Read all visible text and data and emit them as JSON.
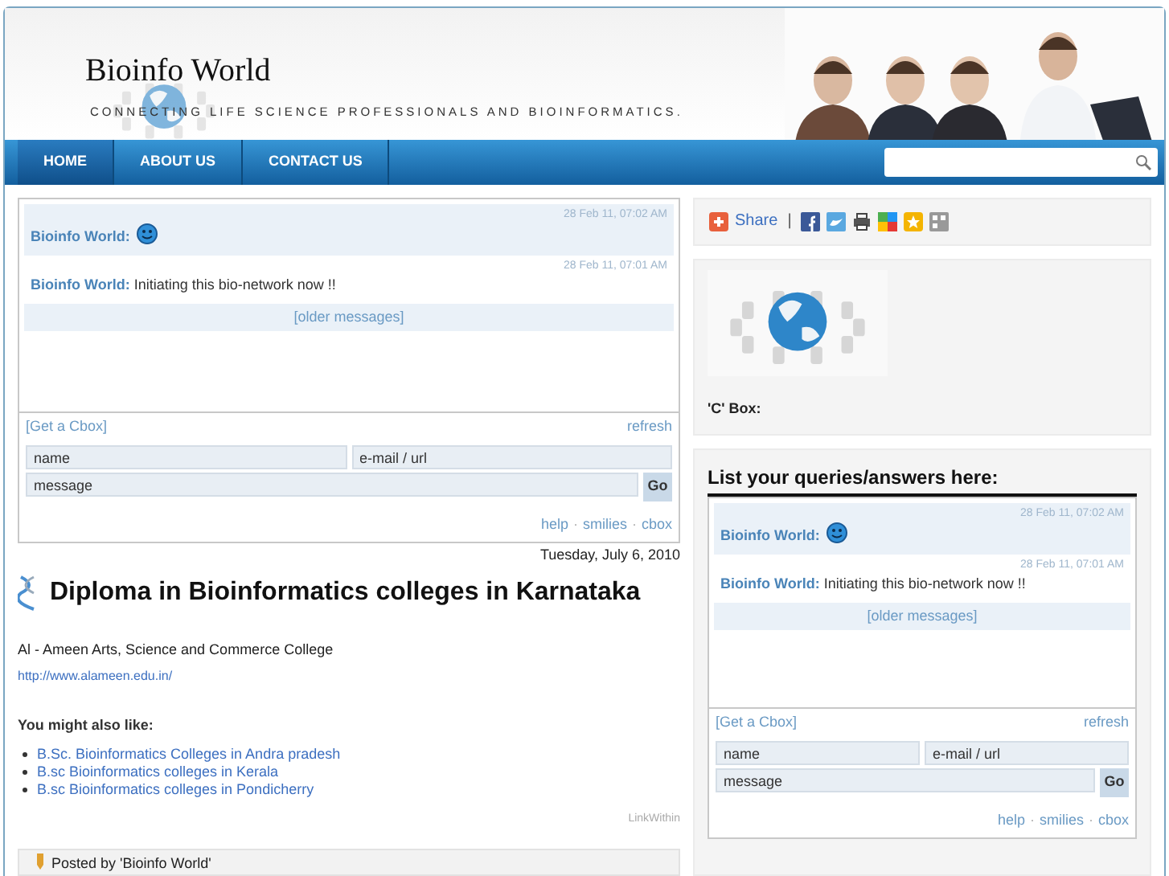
{
  "header": {
    "title": "Bioinfo World",
    "tagline": "CONNECTING LIFE SCIENCE PROFESSIONALS AND BIOINFORMATICS."
  },
  "nav": {
    "tabs": [
      {
        "label": "HOME",
        "selected": true
      },
      {
        "label": "ABOUT US",
        "selected": false
      },
      {
        "label": "CONTACT US",
        "selected": false
      }
    ]
  },
  "main_cbox": {
    "messages": [
      {
        "kind": "smiley",
        "time": "28 Feb 11, 07:02 AM",
        "author": "Bioinfo World:"
      },
      {
        "kind": "text",
        "time": "28 Feb 11, 07:01 AM",
        "author": "Bioinfo World:",
        "text": "Initiating this bio-network now !!"
      }
    ],
    "older": "[older messages]",
    "get_link": "[Get a Cbox]",
    "refresh": "refresh",
    "name_placeholder": "name",
    "email_placeholder": "e-mail / url",
    "message_placeholder": "message",
    "go": "Go",
    "footer_links": [
      "help",
      "smilies",
      "cbox"
    ],
    "separator": "·"
  },
  "post": {
    "date": "Tuesday, July 6, 2010",
    "title": "Diploma in Bioinformatics colleges in Karnataka",
    "body": "Al - Ameen Arts, Science and Commerce College",
    "link": "http://www.alameen.edu.in/",
    "related_heading": "You might also like:",
    "related": [
      "B.Sc. Bioinformatics Colleges in Andra pradesh",
      "B.sc Bioinformatics colleges in Kerala",
      "B.sc Bioinformatics colleges in Pondicherry"
    ],
    "credit": "LinkWithin",
    "posted_by": "Posted by 'Bioinfo World'"
  },
  "sidebar": {
    "share": {
      "label": "Share",
      "separator": "|"
    },
    "cbox_caption": "'C' Box:",
    "queries_heading": "List your queries/answers here:",
    "cbox": {
      "messages": [
        {
          "kind": "smiley",
          "time": "28 Feb 11, 07:02 AM",
          "author": "Bioinfo World:"
        },
        {
          "kind": "text",
          "time": "28 Feb 11, 07:01 AM",
          "author": "Bioinfo World:",
          "text": "Initiating this bio-network now !!"
        }
      ],
      "older": "[older messages]",
      "get_link": "[Get a Cbox]",
      "refresh": "refresh",
      "name_placeholder": "name",
      "email_placeholder": "e-mail / url",
      "message_placeholder": "message",
      "go": "Go",
      "footer_links": [
        "help",
        "smilies",
        "cbox"
      ],
      "separator": "·"
    }
  }
}
